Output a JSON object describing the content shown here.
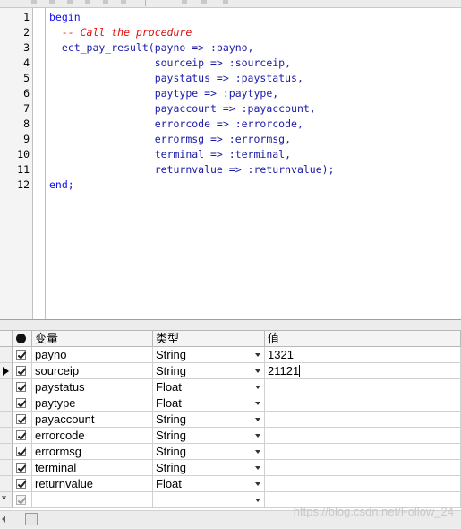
{
  "editor": {
    "lines": [
      {
        "num": "1",
        "parts": [
          {
            "t": "begin",
            "c": "kw"
          }
        ]
      },
      {
        "num": "2",
        "parts": [
          {
            "t": "  ",
            "c": ""
          },
          {
            "t": "-- Call the procedure",
            "c": "cm"
          }
        ]
      },
      {
        "num": "3",
        "parts": [
          {
            "t": "  ect_pay_result(payno => :payno,",
            "c": ""
          }
        ]
      },
      {
        "num": "4",
        "parts": [
          {
            "t": "                 sourceip => :sourceip,",
            "c": ""
          }
        ]
      },
      {
        "num": "5",
        "parts": [
          {
            "t": "                 paystatus => :paystatus,",
            "c": ""
          }
        ]
      },
      {
        "num": "6",
        "parts": [
          {
            "t": "                 paytype => :paytype,",
            "c": ""
          }
        ]
      },
      {
        "num": "7",
        "parts": [
          {
            "t": "                 payaccount => :payaccount,",
            "c": ""
          }
        ]
      },
      {
        "num": "8",
        "parts": [
          {
            "t": "                 errorcode => :errorcode,",
            "c": ""
          }
        ]
      },
      {
        "num": "9",
        "parts": [
          {
            "t": "                 errormsg => :errormsg,",
            "c": ""
          }
        ]
      },
      {
        "num": "10",
        "parts": [
          {
            "t": "                 terminal => :terminal,",
            "c": ""
          }
        ]
      },
      {
        "num": "11",
        "parts": [
          {
            "t": "                 returnvalue => :returnvalue);",
            "c": ""
          }
        ]
      },
      {
        "num": "12",
        "parts": [
          {
            "t": "end;",
            "c": "kw"
          }
        ]
      }
    ]
  },
  "grid": {
    "headers": {
      "variable": "变量",
      "type": "类型",
      "value": "值"
    },
    "rows": [
      {
        "variable": "payno",
        "type": "String",
        "value": "1321",
        "checked": true,
        "current": false
      },
      {
        "variable": "sourceip",
        "type": "String",
        "value": "21121",
        "checked": true,
        "current": true
      },
      {
        "variable": "paystatus",
        "type": "Float",
        "value": "",
        "checked": true,
        "current": false
      },
      {
        "variable": "paytype",
        "type": "Float",
        "value": "",
        "checked": true,
        "current": false
      },
      {
        "variable": "payaccount",
        "type": "String",
        "value": "",
        "checked": true,
        "current": false
      },
      {
        "variable": "errorcode",
        "type": "String",
        "value": "",
        "checked": true,
        "current": false
      },
      {
        "variable": "errormsg",
        "type": "String",
        "value": "",
        "checked": true,
        "current": false
      },
      {
        "variable": "terminal",
        "type": "String",
        "value": "",
        "checked": true,
        "current": false
      },
      {
        "variable": "returnvalue",
        "type": "Float",
        "value": "",
        "checked": true,
        "current": false
      }
    ],
    "new_row_marker": "*"
  },
  "watermark": "https://blog.csdn.net/Follow_24",
  "icons": {
    "warning_header": "exclamation-icon",
    "row_pointer": "current-row-pointer-icon",
    "dropdown": "chevron-down-icon",
    "scroll_left": "scroll-left-arrow-icon"
  }
}
